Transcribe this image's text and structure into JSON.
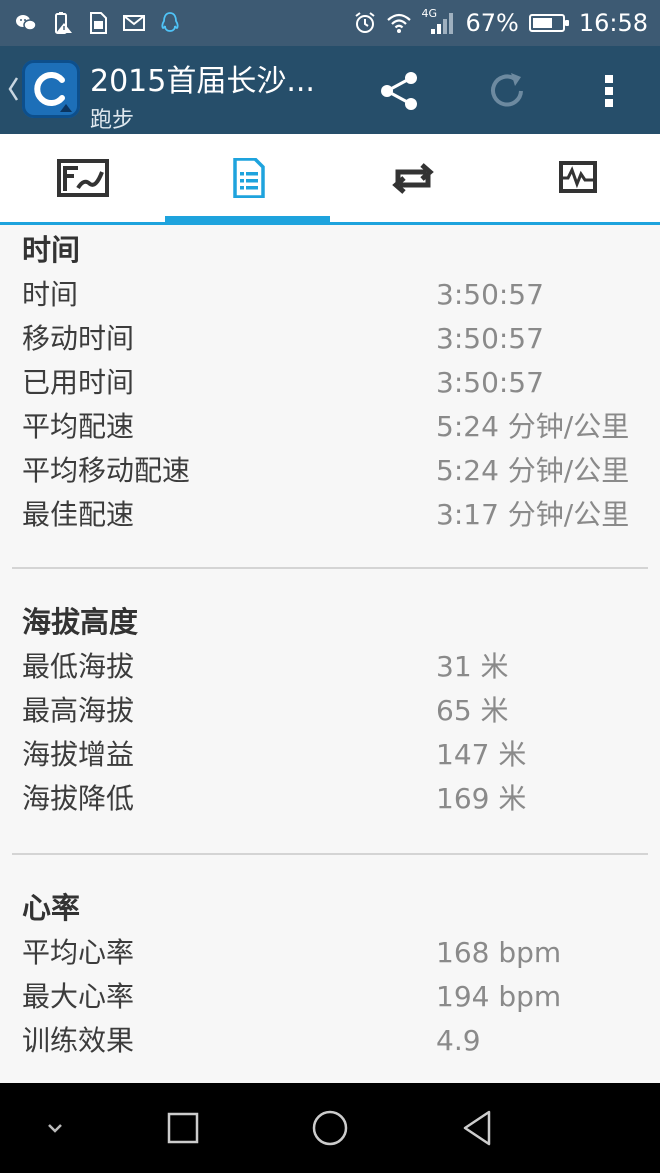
{
  "status_bar": {
    "left_icons": [
      "wechat-icon",
      "battery-alert-icon",
      "sim-alert-icon",
      "mail-icon",
      "qq-icon"
    ],
    "network_label": "4G",
    "battery_percent": "67%",
    "battery_level": 0.67,
    "time": "16:58"
  },
  "app_bar": {
    "title": "2015首届长沙...",
    "subtitle": "跑步",
    "actions": [
      "share-icon",
      "sync-icon",
      "more-vert-icon"
    ]
  },
  "tabs": [
    {
      "name": "map",
      "icon": "map-icon"
    },
    {
      "name": "details",
      "icon": "list-document-icon",
      "active": true
    },
    {
      "name": "laps",
      "icon": "repeat-icon"
    },
    {
      "name": "charts",
      "icon": "chart-icon"
    }
  ],
  "sections": [
    {
      "title": "时间",
      "rows": [
        {
          "label": "时间",
          "value": "3:50:57"
        },
        {
          "label": "移动时间",
          "value": "3:50:57"
        },
        {
          "label": "已用时间",
          "value": "3:50:57"
        },
        {
          "label": "平均配速",
          "value": "5:24 分钟/公里"
        },
        {
          "label": "平均移动配速",
          "value": "5:24 分钟/公里"
        },
        {
          "label": "最佳配速",
          "value": "3:17 分钟/公里"
        }
      ]
    },
    {
      "title": "海拔高度",
      "rows": [
        {
          "label": "最低海拔",
          "value": "31 米"
        },
        {
          "label": "最高海拔",
          "value": "65 米"
        },
        {
          "label": "海拔增益",
          "value": "147 米"
        },
        {
          "label": "海拔降低",
          "value": "169 米"
        }
      ]
    },
    {
      "title": "心率",
      "rows": [
        {
          "label": "平均心率",
          "value": "168 bpm"
        },
        {
          "label": "最大心率",
          "value": "194 bpm"
        },
        {
          "label": "训练效果",
          "value": "4.9"
        }
      ]
    }
  ],
  "colors": {
    "status_bar": "#3d5a73",
    "app_bar": "#264e6a",
    "accent": "#1ea3dd"
  }
}
